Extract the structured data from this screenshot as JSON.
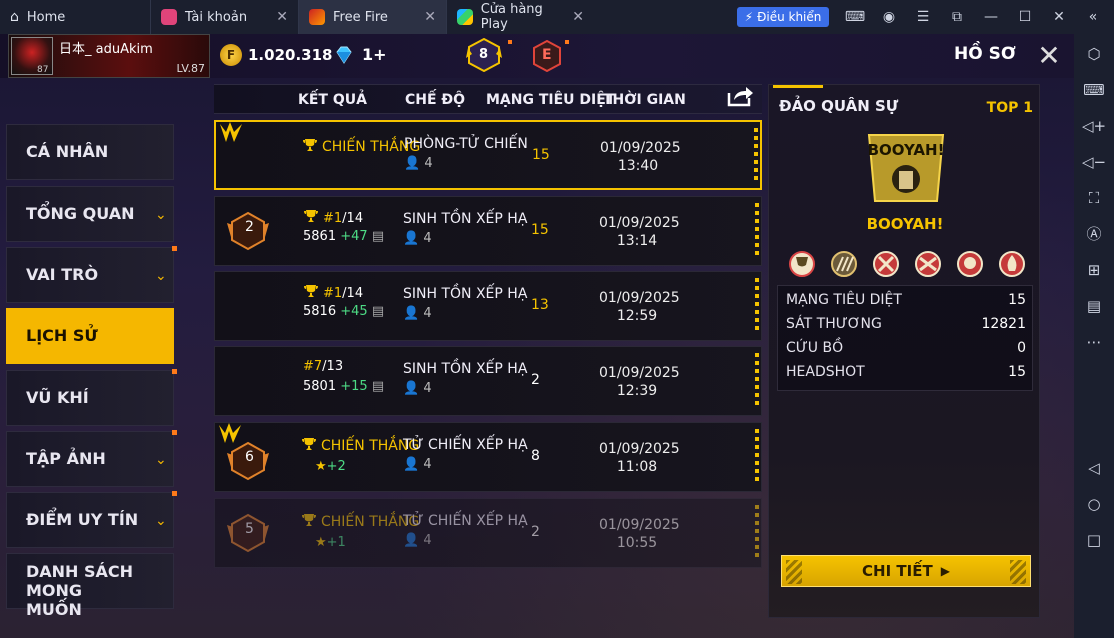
{
  "window": {
    "tabs": [
      {
        "label": "Home"
      },
      {
        "label": "Tài khoản"
      },
      {
        "label": "Free Fire"
      },
      {
        "label": "Cửa hàng Play"
      }
    ],
    "control_button": "Điều khiển"
  },
  "header": {
    "player_name": "日本_ aduAkim",
    "avatar_level": "87",
    "level": "LV.87",
    "gold": "1.020.318",
    "diamonds": "1+",
    "rank_tier": "8",
    "rank_e": "E",
    "page_title": "HỒ SƠ"
  },
  "menu": [
    {
      "label": "CÁ NHÂN"
    },
    {
      "label": "TỔNG QUAN"
    },
    {
      "label": "VAI TRÒ"
    },
    {
      "label": "LỊCH SỬ"
    },
    {
      "label": "VŨ KHÍ"
    },
    {
      "label": "TẬP ẢNH"
    },
    {
      "label": "ĐIỂM UY TÍN"
    },
    {
      "label": "DANH SÁCH MONG MUỐN"
    }
  ],
  "history": {
    "columns": [
      "KẾT QUẢ",
      "CHẾ ĐỘ",
      "MẠNG TIÊU DIỆT",
      "THỜI GIAN"
    ],
    "rows": [
      {
        "result": "CHIẾN THẮNG",
        "rank": "",
        "rank_total": "",
        "points": "",
        "gain": "",
        "stars": "",
        "badge": "",
        "mode": "PHÒNG-TỬ CHIẾN",
        "players": "4",
        "kills": "15",
        "date": "01/09/2025",
        "time": "13:40"
      },
      {
        "result": "",
        "rank": "#1",
        "rank_total": "/14",
        "points": "5861",
        "gain": "+47",
        "stars": "",
        "badge": "2",
        "mode": "SINH TỒN XẾP HẠ",
        "players": "4",
        "kills": "15",
        "date": "01/09/2025",
        "time": "13:14"
      },
      {
        "result": "",
        "rank": "#1",
        "rank_total": "/14",
        "points": "5816",
        "gain": "+45",
        "stars": "",
        "badge": "",
        "mode": "SINH TỒN XẾP HẠ",
        "players": "4",
        "kills": "13",
        "date": "01/09/2025",
        "time": "12:59"
      },
      {
        "result": "",
        "rank": "#7",
        "rank_total": "/13",
        "points": "5801",
        "gain": "+15",
        "stars": "",
        "badge": "",
        "mode": "SINH TỒN XẾP HẠ",
        "players": "4",
        "kills": "2",
        "date": "01/09/2025",
        "time": "12:39"
      },
      {
        "result": "CHIẾN THẮNG",
        "rank": "",
        "rank_total": "",
        "points": "",
        "gain": "",
        "stars": "+2",
        "badge": "6",
        "mode": "TỬ CHIẾN XẾP HẠ",
        "players": "4",
        "kills": "8",
        "date": "01/09/2025",
        "time": "11:08"
      },
      {
        "result": "CHIẾN THẮNG",
        "rank": "",
        "rank_total": "",
        "points": "",
        "gain": "",
        "stars": "+1",
        "badge": "5",
        "mode": "TỬ CHIẾN XẾP HẠ",
        "players": "4",
        "kills": "2",
        "date": "01/09/2025",
        "time": "10:55"
      }
    ]
  },
  "detail": {
    "map": "ĐẢO QUÂN SỰ",
    "top": "TOP 1",
    "result": "BOOYAH!",
    "stats": [
      {
        "label": "MẠNG TIÊU DIỆT",
        "value": "15"
      },
      {
        "label": "SÁT THƯƠNG",
        "value": "12821"
      },
      {
        "label": "CỨU BỒ",
        "value": "0"
      },
      {
        "label": "HEADSHOT",
        "value": "15"
      }
    ],
    "button": "CHI TIẾT"
  },
  "colors": {
    "accent": "#f5c300",
    "gain": "#4ddb85",
    "brand_blue": "#3b6ee8"
  }
}
